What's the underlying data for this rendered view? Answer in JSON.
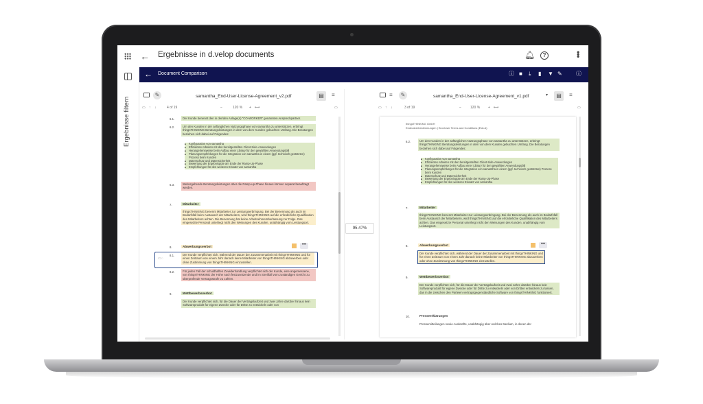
{
  "app": {
    "title": "Ergebnisse in d.velop documents",
    "filter_label": "Ergebnisse filtern"
  },
  "toolbar": {
    "title": "Document Comparison"
  },
  "left_doc": {
    "filename": "samantha_End-User-License-Agreement_v2.pdf",
    "page_info": "4  of 19",
    "zoom": "120  %",
    "sections": [
      {
        "num": "6.1.",
        "text": "Der Kunde benennt den in der/den Anlage(n) \"CO-WORKER\" genannten Ansprechpartner.",
        "color": "g"
      },
      {
        "num": "6.2.",
        "text": "Um den Kunden in der anfänglichen Nutzungsphase von samantha zu unterstützen, erbringt thingsTHINKING Beratungsleistungen in dem von dem Kunden gebuchten Umfang. Die Beratungen beziehen sich dabei auf Folgendes:",
        "color": "g"
      },
      {
        "num": "6.3.",
        "text": "Weitergehende Beratungsleistungen über die Ramp-up-Phase hinaus können separat beauftragt werden.",
        "color": "r"
      },
      {
        "num": "7.",
        "text": "Mitarbeiter",
        "head": true
      },
      {
        "num": "",
        "text": "thingsTHINKING benennt Mitarbeiter zur Leistungserbringung. Bei der Benennung als auch im Bedarfsfall beim Austausch der Mitarbeitern, wird thingsTHINKING auf die erforderliche Qualifikation des Mitarbeiters achten. Die Benennung hat keine Arbeitnehmerüberlassung zur Folge. Das eingesetzte Personal unterliegt nicht den Weisungen des Kunden, unabhängig vom Leistungsort.",
        "color": "y"
      },
      {
        "num": "8.",
        "text": "Abwerbungsverbot",
        "head": true
      },
      {
        "num": "8.1.",
        "text": "Der Kunde verpflichtet sich, während der Dauer der Zusammenarbeit mit thingsTHINKING und für einen Zeitraum von einem Jahr danach keine Mitarbeiter von thingsTHINKING abzuwerben oder ohne Zustimmung von thingsTHINKING einzustellen.",
        "color": "y"
      },
      {
        "num": "8.2.",
        "text": "Für jeden Fall der schuldhaften Zuwiderhandlung verpflichtet sich der Kunde, eine angemessene, von thingsTHINKING der Höhe nach festzusetzende und im Streitfall vom zuständigen Gericht zu überprüfende Vertragsstrafe zu zahlen.",
        "color": "r"
      },
      {
        "num": "9.",
        "text": "Wettbewerbsverbot",
        "head": true
      },
      {
        "num": "",
        "text": "Der Kunde verpflichtet sich, für die Dauer der Vertragslaufzeit und zwei Jahre darüber hinaus kein Softwareprodukt für eigene Zwecke oder für Dritte zu entwickeln oder von",
        "color": "g"
      }
    ],
    "bullets": [
      "Konfiguration von samantha",
      "Effizientes Arbeiten mit den bereitgestellten Client-Side-Anwendungen",
      "Herangehensweise beim Aufbau einer Library für den gewählten Anwendungsfall",
      "Planungsempfehlungen für die Integration von samantha in einem (ggf. technisch gestützten) Prozess beim Kunden",
      "Datenschutz und Datensicherheit",
      "Bewertung der Ergebnisgüte am Ende der Ramp-Up-Phase",
      "Empfehlungen für den weiteren Einsatz von samantha"
    ]
  },
  "right_doc": {
    "filename": "samantha_End-User-License-Agreement_v1.pdf",
    "page_info": "3  of 19",
    "zoom": "120  %",
    "header_line1": "thingsTHINKING GmbH",
    "header_line2": "Endnutzerbestimmungen | End-User Terms and Conditions (EULA)",
    "sections": [
      {
        "num": "6.2.",
        "text": "Um den Kunden in der anfänglichen Nutzungsphase von samantha zu unterstützen, erbringt thingsTHINKING Beratungsleistungen in dem von dem Kunden gebuchten Umfang. Die Beratungen beziehen sich dabei auf Folgendes:"
      },
      {
        "num": "7.",
        "text": "Mitarbeiter",
        "head": true
      },
      {
        "num": "",
        "text": "thingsTHINKING benennt Mitarbeiter zur Leistungserbringung. Bei der Benennung als auch im Bedarfsfall beim Austausch der Mitarbeitern, wird thingsTHINKING auf die erforderliche Qualifikation des Mitarbeiters achten. Das eingesetzte Personal unterliegt nicht den Weisungen des Kunden, unabhängig vom Leistungsort."
      },
      {
        "num": "8.",
        "text": "Abwerbungsverbot",
        "head": true
      },
      {
        "num": "",
        "text": "Der Kunde verpflichtet sich, während der Dauer der Zusammenarbeit mit thingsTHINKING und für einen Zeitraum von einem Jahr danach keine Mitarbeiter von thingsTHINKING abzuwerben oder ohne Zustimmung von thingsTHINKING einzustellen."
      },
      {
        "num": "9.",
        "text": "Wettbewerbsverbot",
        "head": true
      },
      {
        "num": "",
        "text": "Der Kunde verpflichtet sich, für die Dauer der Vertragslaufzeit und zwei Jahre darüber hinaus kein Softwareprodukt für eigene Zwecke oder für Dritte zu entwickeln oder von Dritten entwickeln zu lassen, das in die zwischen den Parteien vertragsgegenständliche Software von thingsTHINKING funktioniert."
      },
      {
        "num": "10.",
        "text": "Presseerklärungen",
        "head": true
      },
      {
        "num": "",
        "text": "Pressemitteilungen sowie Auskünfte, unabhängig über welches Medium, in denen der"
      }
    ],
    "bullets": [
      "Konfiguration von samantha",
      "Effizientes Arbeiten mit den bereitgestellten Client-Side-Anwendungen",
      "Herangehensweise beim Aufbau einer Library für den gewählten Anwendungsfall",
      "Planungsempfehlungen für die Integration von samantha in einem (ggf. technisch gestützten) Prozess beim Kunden",
      "Datenschutz und Datensicherheit",
      "Bewertung der Ergebnisgüte am Ende der Ramp-Up-Phase",
      "Empfehlungen für den weiteren Einsatz von samantha"
    ]
  },
  "similarity": "95.47%",
  "colors": {
    "toolbar_bg": "#101450",
    "match_green": "#dde9c6",
    "removed_red": "#f2c7c3",
    "changed_yellow": "#fbeecb"
  }
}
